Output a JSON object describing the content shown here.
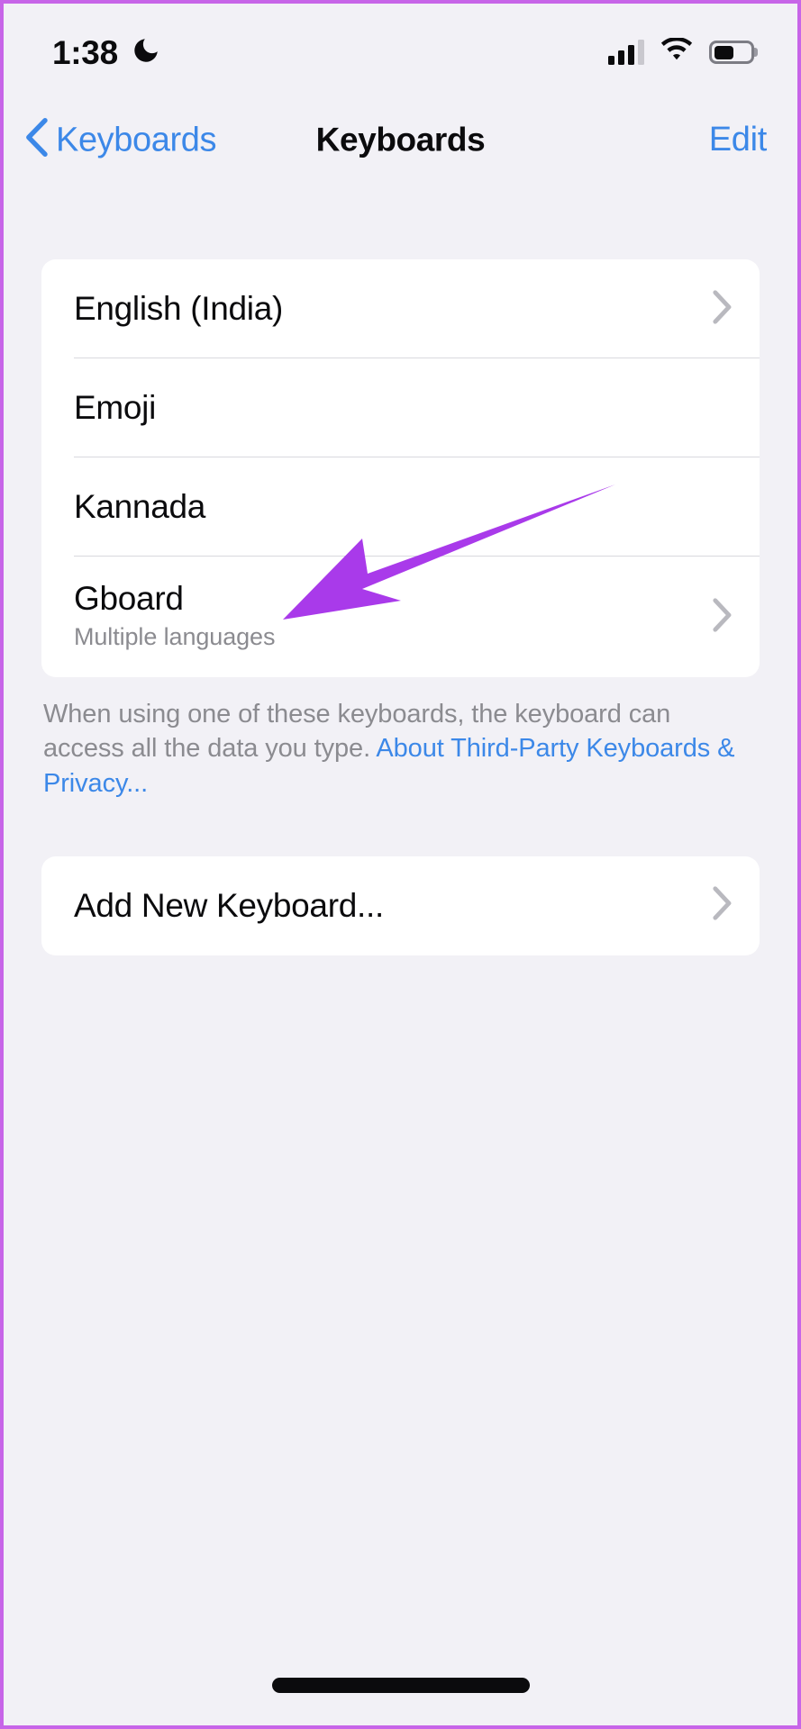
{
  "status_bar": {
    "time": "1:38",
    "focus_icon": "crescent-moon-icon",
    "cellular_icon": "cellular-bars-icon",
    "wifi_icon": "wifi-icon",
    "battery_icon": "battery-icon",
    "battery_level_pct": 55
  },
  "nav": {
    "back_label": "Keyboards",
    "title": "Keyboards",
    "edit_label": "Edit"
  },
  "keyboards_section": {
    "rows": [
      {
        "title": "English (India)",
        "subtitle": "",
        "chevron": true
      },
      {
        "title": "Emoji",
        "subtitle": "",
        "chevron": false
      },
      {
        "title": "Kannada",
        "subtitle": "",
        "chevron": false
      },
      {
        "title": "Gboard",
        "subtitle": "Multiple languages",
        "chevron": true
      }
    ]
  },
  "footer_note": {
    "text_before": "When using one of these keyboards, the keyboard can access all the data you type. ",
    "link_text": "About Third-Party Keyboards & Privacy..."
  },
  "add_section": {
    "rows": [
      {
        "title": "Add New Keyboard...",
        "chevron": true
      }
    ]
  },
  "annotation": {
    "arrow_color": "#a93aea",
    "points_at": "Gboard"
  },
  "colors": {
    "background": "#f2f1f6",
    "card": "#ffffff",
    "accent_blue": "#3c88e8",
    "separator": "#d9d9de",
    "secondary_text": "#8b8b90",
    "frame_border": "#c765e8"
  }
}
